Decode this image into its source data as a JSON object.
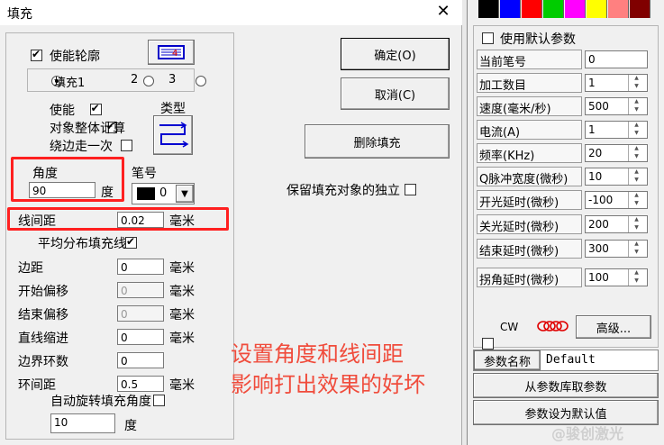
{
  "window": {
    "title": "填充",
    "close_glyph": "✕"
  },
  "left": {
    "enable_outline": "使能轮廓",
    "fill_radios": [
      "填充1",
      "2",
      "3"
    ],
    "enable": "使能",
    "whole_calc": "对象整体计算",
    "go_around_once": "绕边走一次",
    "type_label": "类型",
    "angle_label": "角度",
    "angle_value": "90",
    "angle_unit": "度",
    "pen_label": "笔号",
    "pen_value": "0",
    "line_spacing_label": "线间距",
    "line_spacing_value": "0.02",
    "mm": "毫米",
    "even_distribute": "平均分布填充线",
    "rows": [
      {
        "label": "边距",
        "value": "0",
        "unit": "毫米",
        "disabled": false
      },
      {
        "label": "开始偏移",
        "value": "0",
        "unit": "毫米",
        "disabled": true
      },
      {
        "label": "结束偏移",
        "value": "0",
        "unit": "毫米",
        "disabled": true
      },
      {
        "label": "直线缩进",
        "value": "0",
        "unit": "毫米",
        "disabled": false
      },
      {
        "label": "边界环数",
        "value": "0",
        "unit": "",
        "disabled": false
      },
      {
        "label": "环间距",
        "value": "0.5",
        "unit": "毫米",
        "disabled": false
      }
    ],
    "auto_rotate": "自动旋转填充角度",
    "rotate_value": "10",
    "rotate_unit": "度"
  },
  "buttons": {
    "ok": "确定(O)",
    "cancel": "取消(C)",
    "delete_fill": "删除填充",
    "keep_independent": "保留填充对象的独立"
  },
  "annotation": {
    "line1": "设置角度和线间距",
    "line2": "影响打出效果的好坏"
  },
  "panel": {
    "swatches": [
      "#000000",
      "#0000ff",
      "#ff0000",
      "#00cc00",
      "#ff00ff",
      "#ffff00",
      "#ff8080",
      "#800000"
    ],
    "use_default": "使用默认参数",
    "params": [
      {
        "label": "当前笔号",
        "value": "0",
        "spin": false
      },
      {
        "label": "加工数目",
        "value": "1",
        "spin": true
      },
      {
        "label": "速度(毫米/秒)",
        "value": "500",
        "spin": true
      },
      {
        "label": "电流(A)",
        "value": "1",
        "spin": true
      },
      {
        "label": "频率(KHz)",
        "value": "20",
        "spin": true
      },
      {
        "label": "Q脉冲宽度(微秒)",
        "value": "10",
        "spin": true
      },
      {
        "label": "开光延时(微秒)",
        "value": "-100",
        "spin": true
      },
      {
        "label": "关光延时(微秒)",
        "value": "200",
        "spin": true
      },
      {
        "label": "结束延时(微秒)",
        "value": "300",
        "spin": true
      },
      {
        "label": "拐角延时(微秒)",
        "value": "100",
        "spin": true
      }
    ],
    "cw": "CW",
    "advanced": "高级...",
    "param_name_label": "参数名称",
    "param_name_value": "Default",
    "from_library": "从参数库取参数",
    "set_default": "参数设为默认值"
  },
  "watermark": "@骏创激光"
}
